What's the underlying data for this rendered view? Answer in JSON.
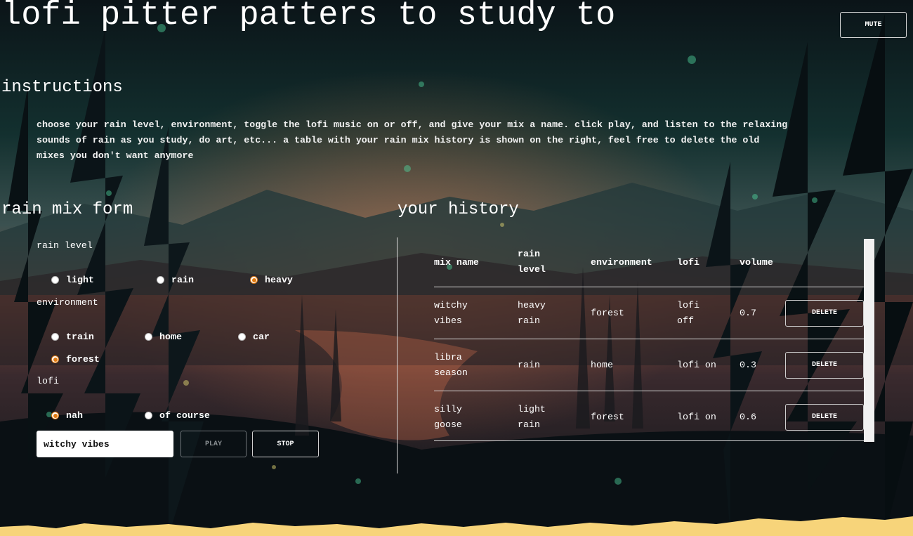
{
  "app": {
    "title": "lofi pitter patters to study to",
    "mute_label": "MUTE"
  },
  "instructions": {
    "heading": "instructions",
    "text": "choose your rain level, environment, toggle the lofi music on or off, and give your mix a name. click play, and listen to the relaxing sounds of rain as you study, do art, etc... a table with your rain mix history is shown on the right, feel free to delete the old mixes you don't want anymore"
  },
  "form": {
    "heading": "rain mix form",
    "rain_level": {
      "label": "rain level",
      "options": [
        {
          "label": "light",
          "checked": false
        },
        {
          "label": "rain",
          "checked": false
        },
        {
          "label": "heavy",
          "checked": true
        }
      ]
    },
    "environment": {
      "label": "environment",
      "options": [
        {
          "label": "train",
          "checked": false
        },
        {
          "label": "home",
          "checked": false
        },
        {
          "label": "car",
          "checked": false
        },
        {
          "label": "forest",
          "checked": true
        }
      ]
    },
    "lofi": {
      "label": "lofi",
      "options": [
        {
          "label": "nah",
          "checked": true
        },
        {
          "label": "of course",
          "checked": false
        }
      ]
    },
    "mix_name_value": "witchy vibes",
    "play_label": "PLAY",
    "stop_label": "STOP"
  },
  "history": {
    "heading": "your history",
    "columns": [
      "mix name",
      "rain level",
      "environment",
      "lofi",
      "volume"
    ],
    "delete_label": "DELETE",
    "rows": [
      {
        "mix_name": "witchy vibes",
        "rain_level": "heavy rain",
        "environment": "forest",
        "lofi": "lofi off",
        "volume": "0.7"
      },
      {
        "mix_name": "libra season",
        "rain_level": "rain",
        "environment": "home",
        "lofi": "lofi on",
        "volume": "0.3"
      },
      {
        "mix_name": "silly goose",
        "rain_level": "light rain",
        "environment": "forest",
        "lofi": "lofi on",
        "volume": "0.6"
      }
    ]
  },
  "colors": {
    "accent_radio": "#e07a10",
    "sand_strip": "#f7d47a",
    "background": "#0c1a1e"
  }
}
